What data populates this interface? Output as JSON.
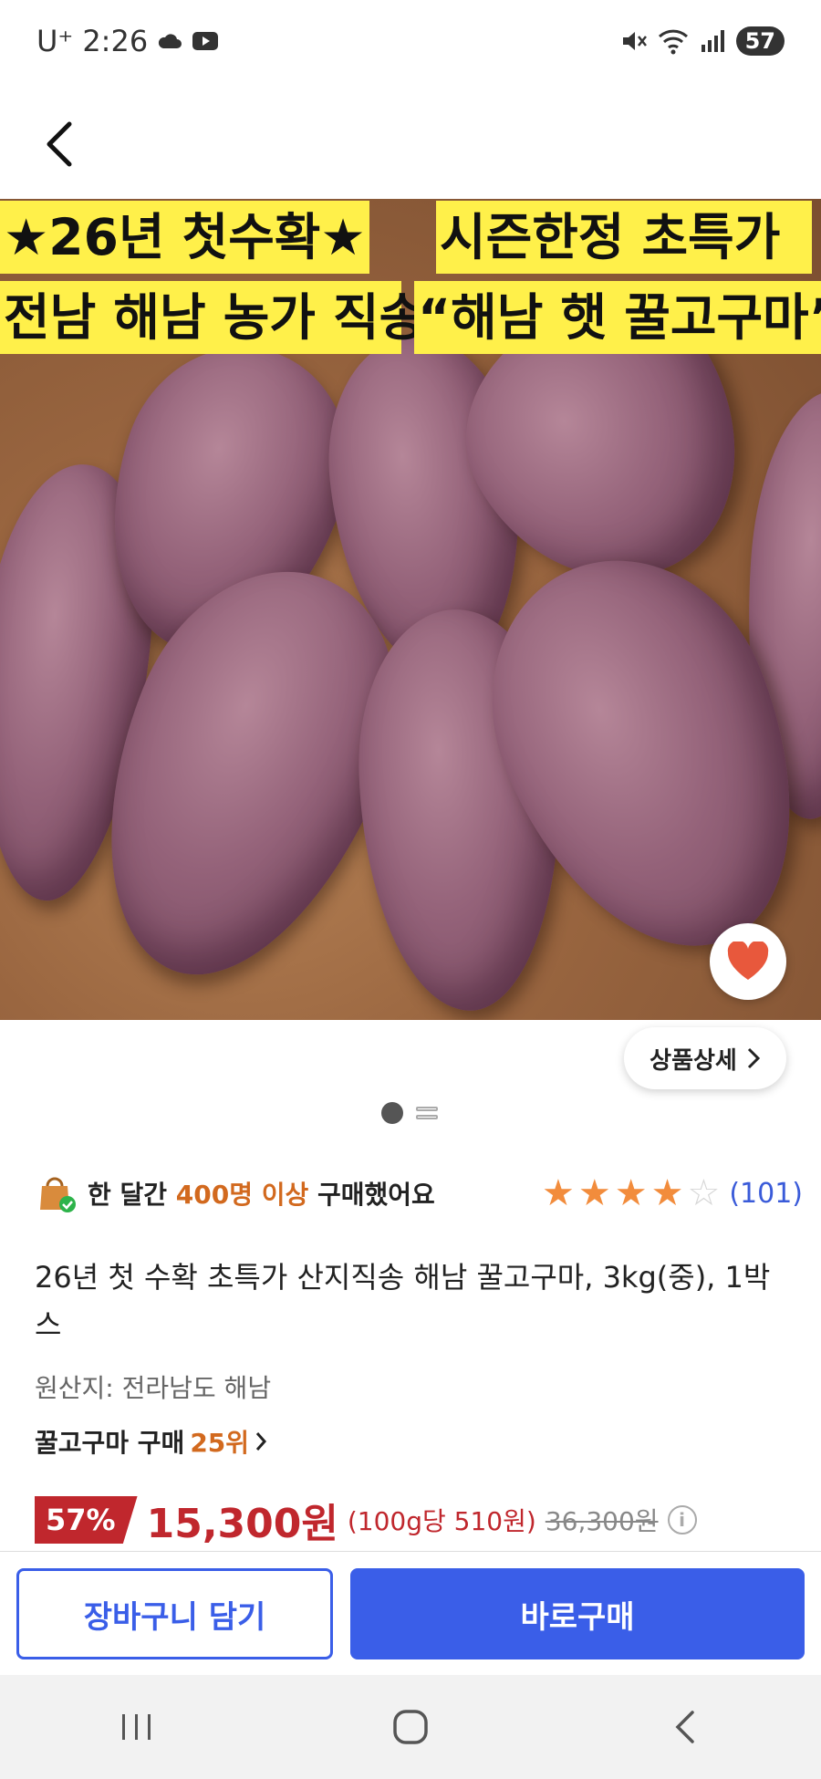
{
  "status_bar": {
    "carrier": "U⁺",
    "time": "2:26",
    "battery": "57"
  },
  "banner": {
    "line1_left": "★26년 첫수확★",
    "line1_right": "시즌한정 초특가",
    "line2_left": "전남 해남 농가 직송",
    "line2_right": "“해남 햇 꿀고구마”"
  },
  "detail_button": {
    "label": "상품상세"
  },
  "purchase_info": {
    "prefix": "한 달간 ",
    "highlight": "400명 이상",
    "suffix": " 구매했어요"
  },
  "rating": {
    "stars_filled": 4,
    "stars_total": 5,
    "review_count": "(101)"
  },
  "product": {
    "title": "26년 첫 수확 초특가 산지직송 해남 꿀고구마, 3kg(중), 1박스",
    "origin": "원산지: 전라남도 해남",
    "rank_prefix": "꿀고구마 구매 ",
    "rank_value": "25위"
  },
  "price": {
    "discount": "57%",
    "sale_price": "15,300원",
    "unit_price": "(100g당 510원)",
    "original_price": "36,300원",
    "info_glyph": "i"
  },
  "actions": {
    "cart_label": "장바구니 담기",
    "buy_label": "바로구매"
  },
  "colors": {
    "accent_blue": "#3a5ee8",
    "price_red": "#c0272d",
    "highlight_orange": "#d2691e",
    "star_orange": "#f28c3c",
    "banner_yellow": "#fff04a"
  }
}
